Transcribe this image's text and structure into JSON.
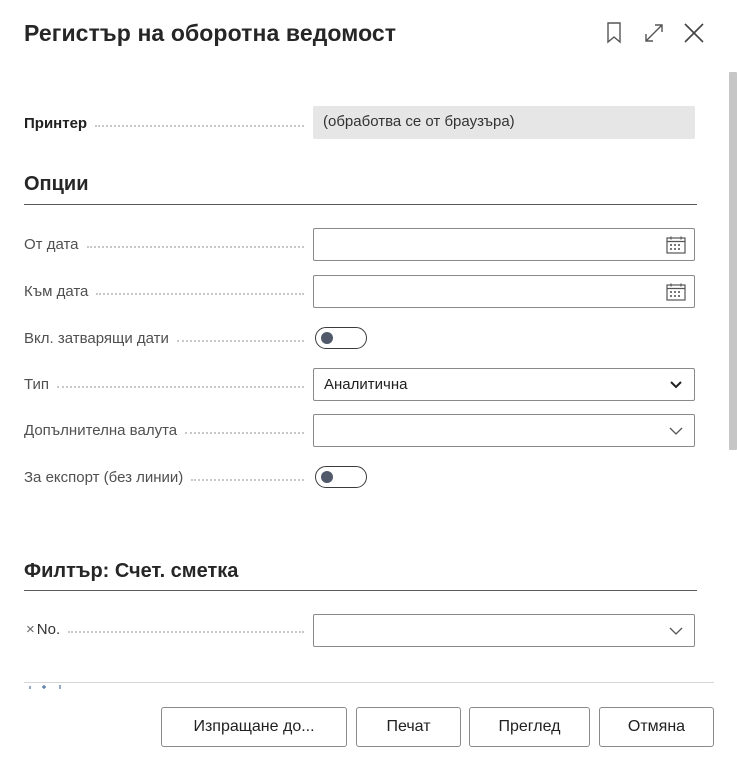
{
  "dialog": {
    "title": "Регистър на оборотна ведомост"
  },
  "printer": {
    "label": "Принтер",
    "value": "(обработва се от браузъра)"
  },
  "options": {
    "section_title": "Опции",
    "from_date": {
      "label": "От дата",
      "value": ""
    },
    "to_date": {
      "label": "Към дата",
      "value": ""
    },
    "include_closing": {
      "label": "Вкл. затварящи дати",
      "checked": false
    },
    "type": {
      "label": "Тип",
      "value": "Аналитична"
    },
    "additional_currency": {
      "label": "Допълнителна валута",
      "value": ""
    },
    "for_export": {
      "label": "За експорт (без линии)",
      "checked": false
    }
  },
  "filter": {
    "section_title": "Филтър: Счет. сметка",
    "no": {
      "label": "No.",
      "value": ""
    },
    "clear_symbol": "×"
  },
  "footer": {
    "send_to": "Изпращане до...",
    "print": "Печат",
    "preview": "Преглед",
    "cancel": "Отмяна"
  },
  "icons": {
    "bookmark": "bookmark-icon",
    "expand": "expand-icon",
    "close": "close-icon",
    "calendar": "calendar-icon",
    "chevron": "chevron-down-icon"
  }
}
